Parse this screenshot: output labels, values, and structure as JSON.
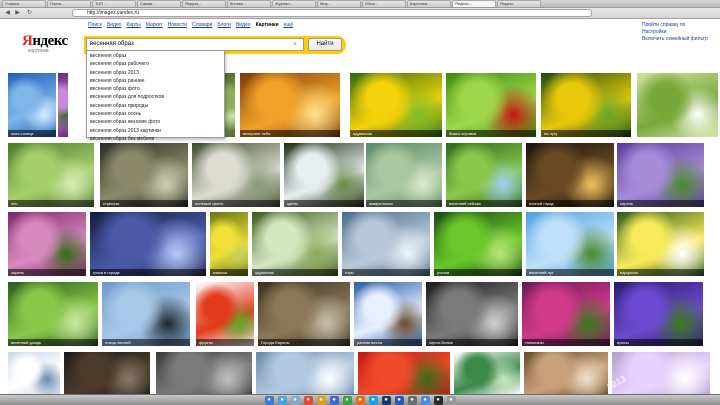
{
  "browser": {
    "tabs": [
      "Учимся...",
      "Поиск...",
      "ТОП ...",
      "Самая...",
      "Яндекс...",
      "Кнопки...",
      "Журнал...",
      "Мир...",
      "Обои...",
      "Картинки...",
      "Яндекс...",
      "Яндекс"
    ],
    "url": "http://images.yandex.ru",
    "back_icon": "arrow-left-icon",
    "forward_icon": "arrow-right-icon"
  },
  "header": {
    "nav": [
      "Поиск",
      "Видео",
      "Карты",
      "Маркет",
      "Новости",
      "Словари",
      "Блоги",
      "Видео",
      "Картинки",
      "ещё"
    ],
    "active_nav_index": 8,
    "right_links": [
      "Пройти справку по",
      "Настройки",
      "Включить семейный фильтр"
    ],
    "logo_text": "Яндекс",
    "logo_sub": "картинки",
    "search_value": "весенняя образ",
    "search_button": "Найти",
    "logo_color": "#e52620",
    "search_bar_color": "#ffcc00"
  },
  "suggestions": [
    "весенняя образ",
    "весенняя образ рабочего",
    "весенняя образ 2013",
    "весенняя образ ранние",
    "весенняя образ фото",
    "весенняя образ для подростков",
    "весенняя образ природы",
    "весенняя образ осень",
    "весенняя образ женские фото",
    "весенняя образ 2013 картинки",
    "весенняя образ без мебели"
  ],
  "images": {
    "row1": [
      {
        "caption": "зона солнце",
        "colors": [
          "#1f5fb8",
          "#7fb6ea",
          "#d6ecff"
        ]
      },
      {
        "caption": "",
        "colors": [
          "#6b2a7a",
          "#c88bd8",
          "#3c6a2a"
        ]
      },
      {
        "caption": "",
        "colors": [
          "#556b2f",
          "#8fae5c",
          "#d5e6b3"
        ]
      },
      {
        "caption": "вечернее небо",
        "colors": [
          "#7a3a05",
          "#f0a12a",
          "#ffe08a"
        ]
      },
      {
        "caption": "одуванчик",
        "colors": [
          "#2d6a12",
          "#f5d20a",
          "#7cbd2a"
        ]
      },
      {
        "caption": "божья коровка",
        "colors": [
          "#3c8a12",
          "#9ed84a",
          "#c21a10"
        ]
      },
      {
        "caption": "на лугу",
        "colors": [
          "#1e4a10",
          "#e8c80a",
          "#6aa52a"
        ]
      },
      {
        "caption": "",
        "colors": [
          "#cfe3a0",
          "#78a83a",
          "#ffffff"
        ]
      }
    ],
    "row2": [
      {
        "caption": "лес",
        "colors": [
          "#4a7a2a",
          "#a6cf6a",
          "#d9ecb5"
        ]
      },
      {
        "caption": "стрекоза",
        "colors": [
          "#2a2a22",
          "#8a8a6a",
          "#cfcfb0"
        ]
      },
      {
        "caption": "полевые цветы",
        "colors": [
          "#3a4a2a",
          "#dcdcd0",
          "#8a9a7a"
        ]
      },
      {
        "caption": "цветы",
        "colors": [
          "#1c2a12",
          "#e6eef0",
          "#6a8a4a"
        ]
      },
      {
        "caption": "акварельная",
        "colors": [
          "#5a8a6a",
          "#a8c8a0",
          "#dfe8c8"
        ]
      },
      {
        "caption": "весенний пейзаж",
        "colors": [
          "#2a6a1a",
          "#8ac84a",
          "#9fd0f0"
        ]
      },
      {
        "caption": "ночной город",
        "colors": [
          "#1a1410",
          "#6a4a22",
          "#f0c060"
        ]
      },
      {
        "caption": "сирень",
        "colors": [
          "#5a3a9a",
          "#a78ad8",
          "#4a8a2a"
        ]
      }
    ],
    "row3": [
      {
        "caption": "сирень",
        "colors": [
          "#7a2a6a",
          "#d88ac0",
          "#3a6a1a"
        ]
      },
      {
        "caption": "гроза в городе",
        "colors": [
          "#141a40",
          "#4a5aa8",
          "#b8c8ff"
        ]
      },
      {
        "caption": "мимоза",
        "colors": [
          "#6a7a12",
          "#f0e03a",
          "#c8d060"
        ]
      },
      {
        "caption": "одуванчик",
        "colors": [
          "#3a5a1a",
          "#d6e6c0",
          "#8aaa5a"
        ]
      },
      {
        "caption": "горы",
        "colors": [
          "#4a6a8a",
          "#b8c8d8",
          "#eef3f8"
        ]
      },
      {
        "caption": "ростки",
        "colors": [
          "#1a4a12",
          "#6ac82a",
          "#b8e67a"
        ]
      },
      {
        "caption": "весенний луг",
        "colors": [
          "#4aa0e0",
          "#bfe0f8",
          "#4a8a2a"
        ]
      },
      {
        "caption": "нарциссы",
        "colors": [
          "#2a5a1a",
          "#f8ea5a",
          "#ffffff"
        ]
      }
    ],
    "row4": [
      {
        "caption": "весенний дождь",
        "colors": [
          "#2a5a1a",
          "#8ac84a",
          "#c8e8a0"
        ]
      },
      {
        "caption": "птицы весной",
        "colors": [
          "#6a98c8",
          "#a8c8e8",
          "#202830"
        ]
      },
      {
        "caption": "фрукты",
        "colors": [
          "#ffffff",
          "#e23a1a",
          "#5aaa2a"
        ]
      },
      {
        "caption": "Города Европы",
        "colors": [
          "#3a3020",
          "#8a7858",
          "#c8c0a8"
        ]
      },
      {
        "caption": "ранняя весна",
        "colors": [
          "#2a5aa8",
          "#e6f0ff",
          "#6a4a2a"
        ]
      },
      {
        "caption": "черно-белые",
        "colors": [
          "#1a1a1a",
          "#7a7a7a",
          "#d0d0d0"
        ]
      },
      {
        "caption": "тюльпаны",
        "colors": [
          "#6a1a5a",
          "#d23a8a",
          "#3a7a1a"
        ]
      },
      {
        "caption": "ирисы",
        "colors": [
          "#2a1a6a",
          "#6a4ad0",
          "#3a7a1a"
        ]
      }
    ],
    "row5": [
      {
        "caption": "",
        "colors": [
          "#c8d8e8",
          "#ffffff",
          "#6a8aaa"
        ]
      },
      {
        "caption": "",
        "colors": [
          "#1a1a1a",
          "#4a3a2a",
          "#8a7a6a"
        ]
      },
      {
        "caption": "",
        "colors": [
          "#3a3a3a",
          "#7a7a7a",
          "#c0c0c0"
        ]
      },
      {
        "caption": "",
        "colors": [
          "#6a8aaa",
          "#b0c8e0",
          "#ffffff"
        ]
      },
      {
        "caption": "",
        "colors": [
          "#c21a10",
          "#f04a2a",
          "#3a6a1a"
        ]
      },
      {
        "caption": "",
        "colors": [
          "#ffffff",
          "#3a8a4a",
          "#c8e8c0"
        ]
      },
      {
        "caption": "",
        "colors": [
          "#6a4a2a",
          "#c8a07a",
          "#f0e0c8"
        ]
      },
      {
        "caption": "",
        "colors": [
          "#b0a0c8",
          "#e8d0ff",
          "#ffffff"
        ]
      }
    ]
  },
  "watermark": "2013",
  "dock": [
    {
      "icon": "finder-icon",
      "color": "#3a7ad8"
    },
    {
      "icon": "safari-icon",
      "color": "#4aa0e0"
    },
    {
      "icon": "mail-icon",
      "color": "#8aa8c8"
    },
    {
      "icon": "calendar-icon",
      "color": "#e24a3a"
    },
    {
      "icon": "photos-icon",
      "color": "#d8a020"
    },
    {
      "icon": "itunes-icon",
      "color": "#3a6ad0"
    },
    {
      "icon": "chrome-icon",
      "color": "#3aa04a"
    },
    {
      "icon": "firefox-icon",
      "color": "#e2701a"
    },
    {
      "icon": "skype-icon",
      "color": "#1aa0e0"
    },
    {
      "icon": "photoshop-icon",
      "color": "#1a3a6a"
    },
    {
      "icon": "word-icon",
      "color": "#2a5ab0"
    },
    {
      "icon": "settings-icon",
      "color": "#6a6a6a"
    },
    {
      "icon": "appstore-icon",
      "color": "#4a8ae0"
    },
    {
      "icon": "terminal-icon",
      "color": "#2a2a2a"
    },
    {
      "icon": "trash-icon",
      "color": "#9a9a9a"
    }
  ]
}
